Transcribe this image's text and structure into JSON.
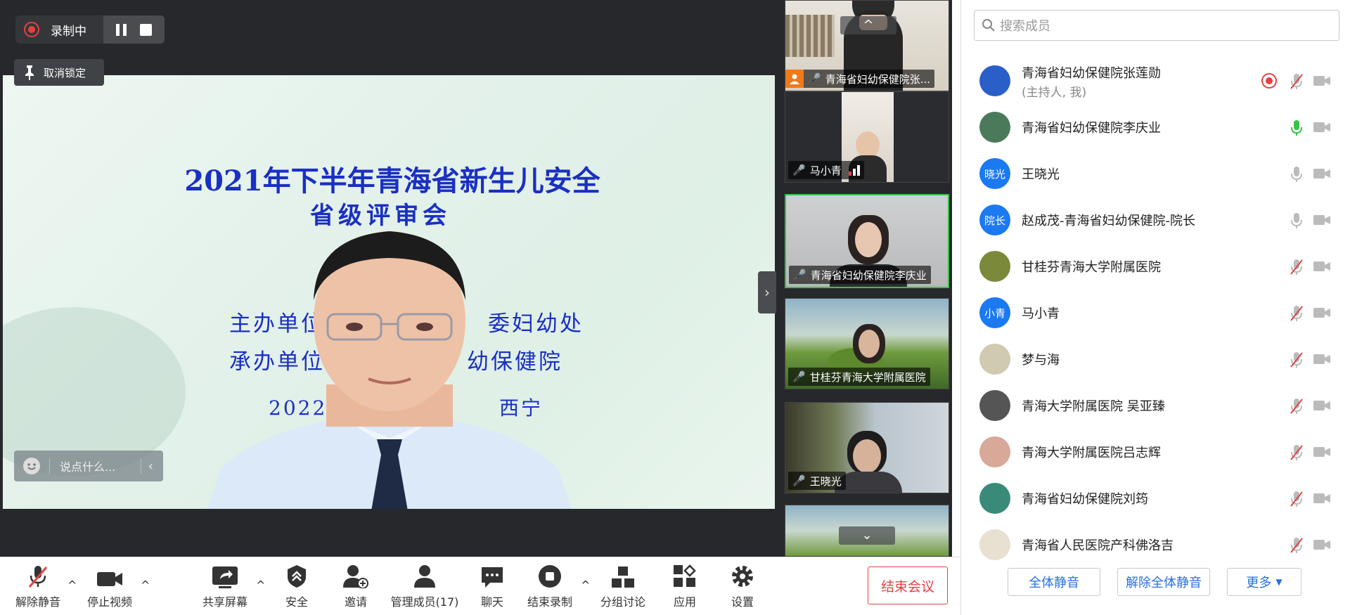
{
  "recording": {
    "label": "录制中"
  },
  "unlock": {
    "label": "取消锁定"
  },
  "chat": {
    "placeholder": "说点什么..."
  },
  "slide": {
    "title_line1": "2021年下半年青海省新生儿安全",
    "title_line2": "省级评审会",
    "organizer": "主办单位",
    "organizer_tail": "委妇幼处",
    "host": "承办单位:",
    "host_tail": "幼保健院",
    "date": "2022年",
    "place": "西宁"
  },
  "thumbnails": [
    {
      "name": "青海省妇幼保健院张..."
    },
    {
      "name": "马小青"
    },
    {
      "name": "青海省妇幼保健院李庆业"
    },
    {
      "name": "甘桂芬青海大学附属医院"
    },
    {
      "name": "王晓光"
    }
  ],
  "toolbar": {
    "unmute": "解除静音",
    "stop_video": "停止视频",
    "share": "共享屏幕",
    "security": "安全",
    "invite": "邀请",
    "manage": "管理成员(17)",
    "chat": "聊天",
    "end_record": "结束录制",
    "breakout": "分组讨论",
    "apps": "应用",
    "settings": "设置",
    "end_meeting": "结束会议"
  },
  "panel": {
    "search_placeholder": "搜索成员",
    "members": [
      {
        "name": "青海省妇幼保健院张莲勋",
        "sub": "(主持人, 我)",
        "avatar": "",
        "avatar_color": "#2a5fc8",
        "mic": "muted",
        "recording": true
      },
      {
        "name": "青海省妇幼保健院李庆业",
        "sub": "",
        "avatar": "",
        "avatar_color": "#4a7a5a",
        "mic": "active"
      },
      {
        "name": "王晓光",
        "sub": "",
        "avatar": "晓光",
        "avatar_color": "#1b79f2",
        "mic": "on"
      },
      {
        "name": "赵成茂-青海省妇幼保健院-院长",
        "sub": "",
        "avatar": "院长",
        "avatar_color": "#1b79f2",
        "mic": "on"
      },
      {
        "name": "甘桂芬青海大学附属医院",
        "sub": "",
        "avatar": "",
        "avatar_color": "#7a8a3a",
        "mic": "muted"
      },
      {
        "name": "马小青",
        "sub": "",
        "avatar": "小青",
        "avatar_color": "#1b79f2",
        "mic": "muted"
      },
      {
        "name": "梦与海",
        "sub": "",
        "avatar": "",
        "avatar_color": "#cfcab0",
        "mic": "muted"
      },
      {
        "name": "青海大学附属医院 吴亚臻",
        "sub": "",
        "avatar": "",
        "avatar_color": "#555",
        "mic": "muted"
      },
      {
        "name": "青海大学附属医院吕志辉",
        "sub": "",
        "avatar": "",
        "avatar_color": "#d8a898",
        "mic": "muted"
      },
      {
        "name": "青海省妇幼保健院刘筠",
        "sub": "",
        "avatar": "",
        "avatar_color": "#3a8a7a",
        "mic": "muted"
      },
      {
        "name": "青海省人民医院产科佛洛吉",
        "sub": "",
        "avatar": "",
        "avatar_color": "#e8e0d0",
        "mic": "muted"
      }
    ],
    "mute_all": "全体静音",
    "unmute_all": "解除全体静音",
    "more": "更多"
  },
  "colors": {
    "accent": "#1b79f2",
    "danger": "#e34343",
    "active_mic": "#37c24a"
  }
}
